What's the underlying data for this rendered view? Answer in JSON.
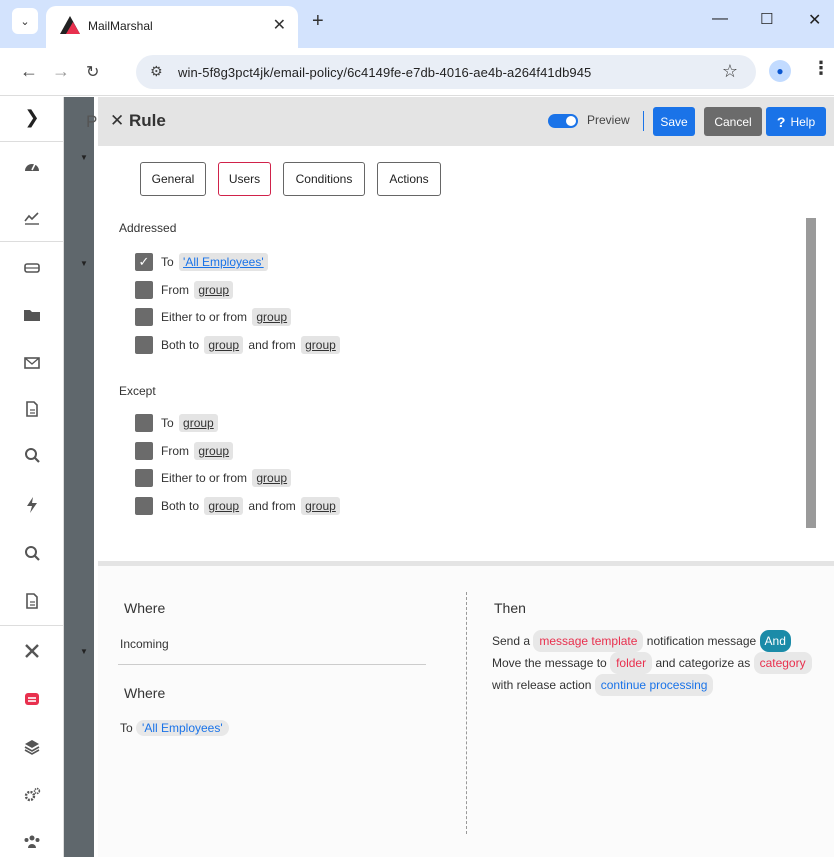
{
  "browser": {
    "tab_title": "MailMarshal",
    "url": "win-5f8g3pct4jk/email-policy/6c4149fe-e7db-4016-ae4b-a264f41db945"
  },
  "rail": {
    "letter": "P"
  },
  "header": {
    "title": "Rule",
    "preview_label": "Preview",
    "save_label": "Save",
    "cancel_label": "Cancel",
    "help_label": "Help"
  },
  "tabs": [
    {
      "label": "General"
    },
    {
      "label": "Users"
    },
    {
      "label": "Conditions"
    },
    {
      "label": "Actions"
    }
  ],
  "addressed": {
    "label": "Addressed",
    "to": {
      "text": "To",
      "value": "'All Employees'",
      "checked": true
    },
    "from": {
      "text": "From",
      "value": "group"
    },
    "either": {
      "text": "Either to or from",
      "value": "group"
    },
    "both": {
      "text1": "Both to",
      "value1": "group",
      "text2": "and from",
      "value2": "group"
    }
  },
  "except": {
    "label": "Except",
    "to": {
      "text": "To",
      "value": "group"
    },
    "from": {
      "text": "From",
      "value": "group"
    },
    "either": {
      "text": "Either to or from",
      "value": "group"
    },
    "both": {
      "text1": "Both to",
      "value1": "group",
      "text2": "and from",
      "value2": "group"
    }
  },
  "summary": {
    "where1_title": "Where",
    "where1_value": "Incoming",
    "where2_title": "Where",
    "where2_prefix": "To",
    "where2_value": "'All Employees'",
    "then_title": "Then",
    "then": {
      "send_a": "Send a",
      "message_template": "message template",
      "notification_message": "notification message",
      "and": "And",
      "move": "Move the message to",
      "folder": "folder",
      "and_categorize": "and categorize",
      "as": "as",
      "category": "category",
      "with_release": "with release action",
      "continue_processing": "continue processing"
    }
  }
}
